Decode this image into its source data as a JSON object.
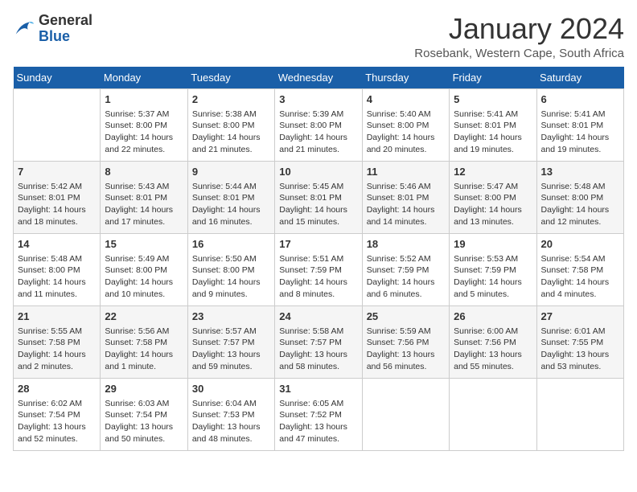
{
  "app": {
    "logo_general": "General",
    "logo_blue": "Blue",
    "month_title": "January 2024",
    "location": "Rosebank, Western Cape, South Africa"
  },
  "calendar": {
    "headers": [
      "Sunday",
      "Monday",
      "Tuesday",
      "Wednesday",
      "Thursday",
      "Friday",
      "Saturday"
    ],
    "weeks": [
      [
        {
          "day": "",
          "content": ""
        },
        {
          "day": "1",
          "content": "Sunrise: 5:37 AM\nSunset: 8:00 PM\nDaylight: 14 hours\nand 22 minutes."
        },
        {
          "day": "2",
          "content": "Sunrise: 5:38 AM\nSunset: 8:00 PM\nDaylight: 14 hours\nand 21 minutes."
        },
        {
          "day": "3",
          "content": "Sunrise: 5:39 AM\nSunset: 8:00 PM\nDaylight: 14 hours\nand 21 minutes."
        },
        {
          "day": "4",
          "content": "Sunrise: 5:40 AM\nSunset: 8:00 PM\nDaylight: 14 hours\nand 20 minutes."
        },
        {
          "day": "5",
          "content": "Sunrise: 5:41 AM\nSunset: 8:01 PM\nDaylight: 14 hours\nand 19 minutes."
        },
        {
          "day": "6",
          "content": "Sunrise: 5:41 AM\nSunset: 8:01 PM\nDaylight: 14 hours\nand 19 minutes."
        }
      ],
      [
        {
          "day": "7",
          "content": "Sunrise: 5:42 AM\nSunset: 8:01 PM\nDaylight: 14 hours\nand 18 minutes."
        },
        {
          "day": "8",
          "content": "Sunrise: 5:43 AM\nSunset: 8:01 PM\nDaylight: 14 hours\nand 17 minutes."
        },
        {
          "day": "9",
          "content": "Sunrise: 5:44 AM\nSunset: 8:01 PM\nDaylight: 14 hours\nand 16 minutes."
        },
        {
          "day": "10",
          "content": "Sunrise: 5:45 AM\nSunset: 8:01 PM\nDaylight: 14 hours\nand 15 minutes."
        },
        {
          "day": "11",
          "content": "Sunrise: 5:46 AM\nSunset: 8:01 PM\nDaylight: 14 hours\nand 14 minutes."
        },
        {
          "day": "12",
          "content": "Sunrise: 5:47 AM\nSunset: 8:00 PM\nDaylight: 14 hours\nand 13 minutes."
        },
        {
          "day": "13",
          "content": "Sunrise: 5:48 AM\nSunset: 8:00 PM\nDaylight: 14 hours\nand 12 minutes."
        }
      ],
      [
        {
          "day": "14",
          "content": "Sunrise: 5:48 AM\nSunset: 8:00 PM\nDaylight: 14 hours\nand 11 minutes."
        },
        {
          "day": "15",
          "content": "Sunrise: 5:49 AM\nSunset: 8:00 PM\nDaylight: 14 hours\nand 10 minutes."
        },
        {
          "day": "16",
          "content": "Sunrise: 5:50 AM\nSunset: 8:00 PM\nDaylight: 14 hours\nand 9 minutes."
        },
        {
          "day": "17",
          "content": "Sunrise: 5:51 AM\nSunset: 7:59 PM\nDaylight: 14 hours\nand 8 minutes."
        },
        {
          "day": "18",
          "content": "Sunrise: 5:52 AM\nSunset: 7:59 PM\nDaylight: 14 hours\nand 6 minutes."
        },
        {
          "day": "19",
          "content": "Sunrise: 5:53 AM\nSunset: 7:59 PM\nDaylight: 14 hours\nand 5 minutes."
        },
        {
          "day": "20",
          "content": "Sunrise: 5:54 AM\nSunset: 7:58 PM\nDaylight: 14 hours\nand 4 minutes."
        }
      ],
      [
        {
          "day": "21",
          "content": "Sunrise: 5:55 AM\nSunset: 7:58 PM\nDaylight: 14 hours\nand 2 minutes."
        },
        {
          "day": "22",
          "content": "Sunrise: 5:56 AM\nSunset: 7:58 PM\nDaylight: 14 hours\nand 1 minute."
        },
        {
          "day": "23",
          "content": "Sunrise: 5:57 AM\nSunset: 7:57 PM\nDaylight: 13 hours\nand 59 minutes."
        },
        {
          "day": "24",
          "content": "Sunrise: 5:58 AM\nSunset: 7:57 PM\nDaylight: 13 hours\nand 58 minutes."
        },
        {
          "day": "25",
          "content": "Sunrise: 5:59 AM\nSunset: 7:56 PM\nDaylight: 13 hours\nand 56 minutes."
        },
        {
          "day": "26",
          "content": "Sunrise: 6:00 AM\nSunset: 7:56 PM\nDaylight: 13 hours\nand 55 minutes."
        },
        {
          "day": "27",
          "content": "Sunrise: 6:01 AM\nSunset: 7:55 PM\nDaylight: 13 hours\nand 53 minutes."
        }
      ],
      [
        {
          "day": "28",
          "content": "Sunrise: 6:02 AM\nSunset: 7:54 PM\nDaylight: 13 hours\nand 52 minutes."
        },
        {
          "day": "29",
          "content": "Sunrise: 6:03 AM\nSunset: 7:54 PM\nDaylight: 13 hours\nand 50 minutes."
        },
        {
          "day": "30",
          "content": "Sunrise: 6:04 AM\nSunset: 7:53 PM\nDaylight: 13 hours\nand 48 minutes."
        },
        {
          "day": "31",
          "content": "Sunrise: 6:05 AM\nSunset: 7:52 PM\nDaylight: 13 hours\nand 47 minutes."
        },
        {
          "day": "",
          "content": ""
        },
        {
          "day": "",
          "content": ""
        },
        {
          "day": "",
          "content": ""
        }
      ]
    ]
  }
}
